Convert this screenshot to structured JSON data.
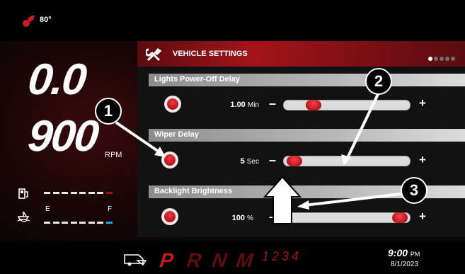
{
  "status": {
    "temperature": "80°"
  },
  "dash": {
    "speed": "0.0",
    "rpm_value": "900",
    "rpm_unit": "RPM",
    "fuel_level_segments_on": 7,
    "fuel_level_segments_total": 8,
    "trim_empty_label": "E",
    "trim_full_label": "F",
    "temperature_icon": "thermometer-icon",
    "fuel_icon": "fuel-pump-icon",
    "trim_icon": "boat-trim-icon"
  },
  "settings_panel": {
    "title": "VEHICLE SETTINGS",
    "page_dots_total": 5,
    "page_dots_active_index": 0,
    "header_icon": "wrench-screwdriver-icon",
    "items": [
      {
        "label": "Lights Power-Off Delay",
        "value": "1.00",
        "unit": "Min",
        "slider_level": 0.2
      },
      {
        "label": "Wiper Delay",
        "value": "5",
        "unit": "Sec",
        "slider_level": 0.02
      },
      {
        "label": "Backlight Brightness",
        "value": "100",
        "unit": "%",
        "slider_level": 1.0
      }
    ],
    "minus_label": "–",
    "plus_label": "+"
  },
  "bottom": {
    "gears": [
      "P",
      "R",
      "N",
      "M"
    ],
    "active_gear": "P",
    "gear_numbers": "1234",
    "time": "9:00",
    "time_suffix": "PM",
    "date": "8/1/2023",
    "cruise_icon": "trailer-icon"
  },
  "callouts": [
    "1",
    "2",
    "3"
  ],
  "colors": {
    "accent_red": "#b3121b",
    "background": "#050505",
    "white": "#ffffff"
  }
}
